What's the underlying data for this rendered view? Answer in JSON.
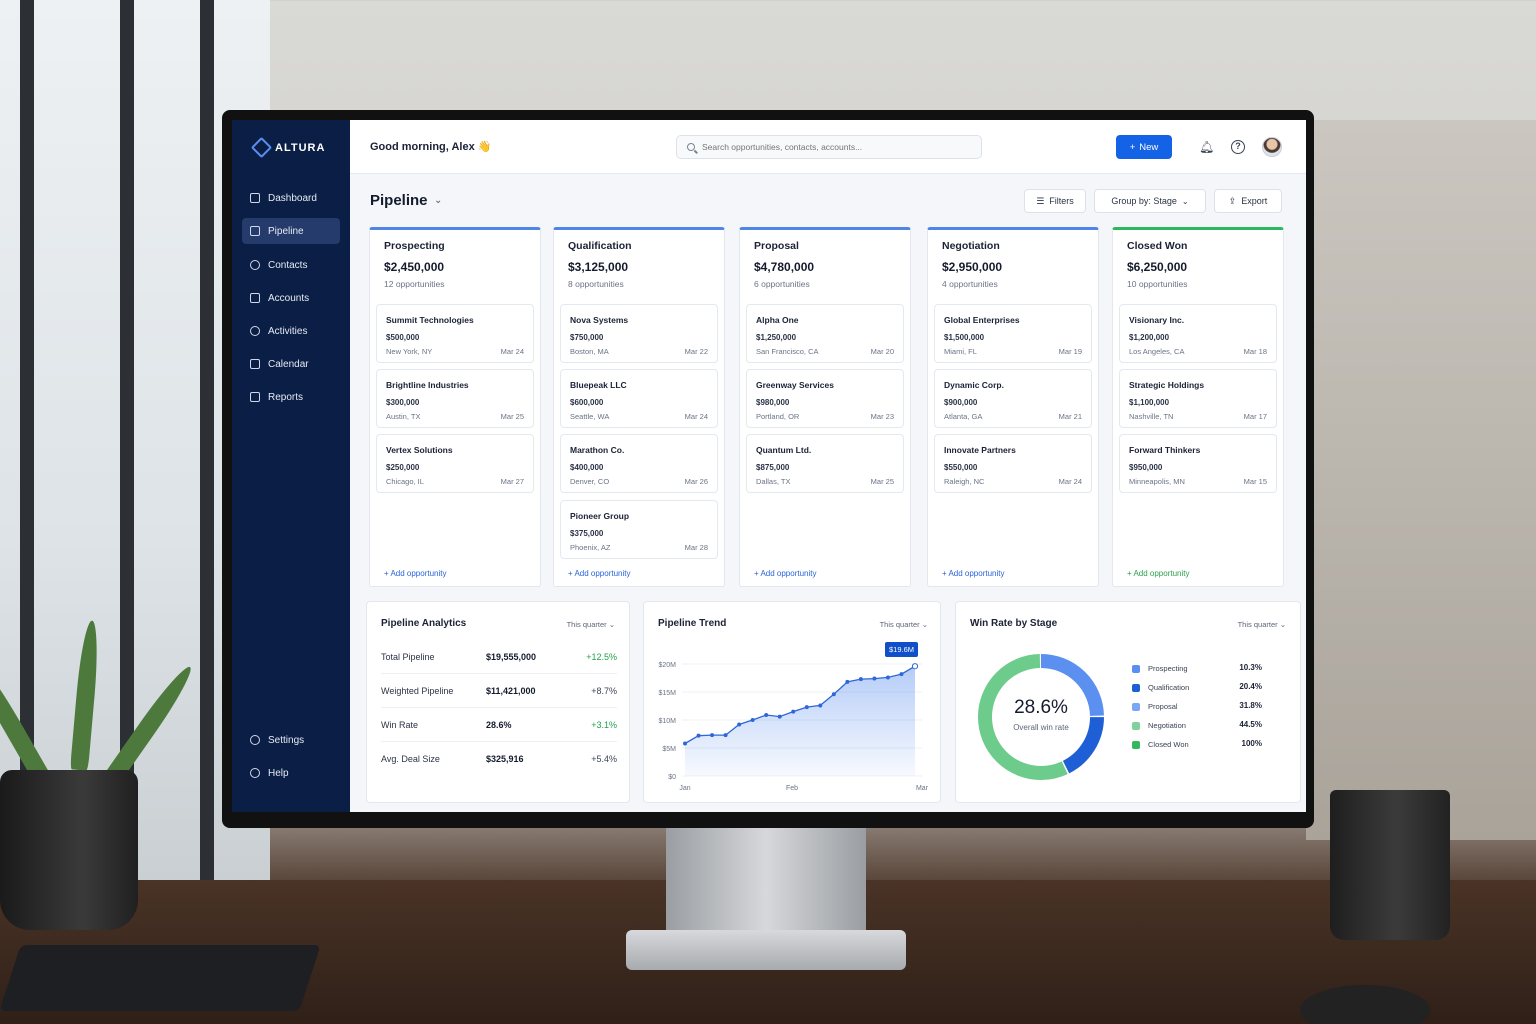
{
  "app": {
    "brand": "ALTURA",
    "greeting": "Good morning, Alex 👋"
  },
  "search": {
    "placeholder": "Search opportunities, contacts, accounts..."
  },
  "header": {
    "new_label": "New"
  },
  "sidebar": {
    "items": [
      {
        "label": "Dashboard",
        "icon": "dashboard-icon"
      },
      {
        "label": "Pipeline",
        "icon": "pipeline-icon",
        "active": true
      },
      {
        "label": "Contacts",
        "icon": "contacts-icon"
      },
      {
        "label": "Accounts",
        "icon": "accounts-icon"
      },
      {
        "label": "Activities",
        "icon": "activities-icon"
      },
      {
        "label": "Calendar",
        "icon": "calendar-icon"
      },
      {
        "label": "Reports",
        "icon": "reports-icon"
      }
    ],
    "bottom": [
      {
        "label": "Settings",
        "icon": "gear-icon"
      },
      {
        "label": "Help",
        "icon": "help-icon"
      }
    ]
  },
  "page": {
    "title": "Pipeline",
    "filters_label": "Filters",
    "group_label": "Group by: Stage",
    "export_label": "Export"
  },
  "stages": [
    {
      "name": "Prospecting",
      "total": "$2,450,000",
      "count": "12 opportunities",
      "deals": [
        {
          "name": "Summit Technologies",
          "amount": "$500,000",
          "location": "New York, NY",
          "date": "Mar 24"
        },
        {
          "name": "Brightline Industries",
          "amount": "$300,000",
          "location": "Austin, TX",
          "date": "Mar 25"
        },
        {
          "name": "Vertex Solutions",
          "amount": "$250,000",
          "location": "Chicago, IL",
          "date": "Mar 27"
        }
      ],
      "add": "+ Add opportunity"
    },
    {
      "name": "Qualification",
      "total": "$3,125,000",
      "count": "8 opportunities",
      "deals": [
        {
          "name": "Nova Systems",
          "amount": "$750,000",
          "location": "Boston, MA",
          "date": "Mar 22"
        },
        {
          "name": "Bluepeak LLC",
          "amount": "$600,000",
          "location": "Seattle, WA",
          "date": "Mar 24"
        },
        {
          "name": "Marathon Co.",
          "amount": "$400,000",
          "location": "Denver, CO",
          "date": "Mar 26"
        },
        {
          "name": "Pioneer Group",
          "amount": "$375,000",
          "location": "Phoenix, AZ",
          "date": "Mar 28"
        }
      ],
      "add": "+ Add opportunity"
    },
    {
      "name": "Proposal",
      "total": "$4,780,000",
      "count": "6 opportunities",
      "deals": [
        {
          "name": "Alpha One",
          "amount": "$1,250,000",
          "location": "San Francisco, CA",
          "date": "Mar 20"
        },
        {
          "name": "Greenway Services",
          "amount": "$980,000",
          "location": "Portland, OR",
          "date": "Mar 23"
        },
        {
          "name": "Quantum Ltd.",
          "amount": "$875,000",
          "location": "Dallas, TX",
          "date": "Mar 25"
        }
      ],
      "add": "+ Add opportunity"
    },
    {
      "name": "Negotiation",
      "total": "$2,950,000",
      "count": "4 opportunities",
      "deals": [
        {
          "name": "Global Enterprises",
          "amount": "$1,500,000",
          "location": "Miami, FL",
          "date": "Mar 19"
        },
        {
          "name": "Dynamic Corp.",
          "amount": "$900,000",
          "location": "Atlanta, GA",
          "date": "Mar 21"
        },
        {
          "name": "Innovate Partners",
          "amount": "$550,000",
          "location": "Raleigh, NC",
          "date": "Mar 24"
        }
      ],
      "add": "+ Add opportunity"
    },
    {
      "name": "Closed Won",
      "total": "$6,250,000",
      "count": "10 opportunities",
      "deals": [
        {
          "name": "Visionary Inc.",
          "amount": "$1,200,000",
          "location": "Los Angeles, CA",
          "date": "Mar 18"
        },
        {
          "name": "Strategic Holdings",
          "amount": "$1,100,000",
          "location": "Nashville, TN",
          "date": "Mar 17"
        },
        {
          "name": "Forward Thinkers",
          "amount": "$950,000",
          "location": "Minneapolis, MN",
          "date": "Mar 15"
        }
      ],
      "add": "+ Add opportunity"
    }
  ],
  "analytics": {
    "title": "Pipeline Analytics",
    "range": "This quarter",
    "metrics": [
      {
        "label": "Total Pipeline",
        "value": "$19,555,000",
        "change": "+12.5%",
        "positive": true
      },
      {
        "label": "Weighted Pipeline",
        "value": "$11,421,000",
        "change": "+8.7%",
        "positive": false
      },
      {
        "label": "Win Rate",
        "value": "28.6%",
        "change": "+3.1%",
        "positive": true
      },
      {
        "label": "Avg. Deal Size",
        "value": "$325,916",
        "change": "+5.4%",
        "positive": false
      }
    ]
  },
  "trend": {
    "title": "Pipeline Trend",
    "range": "This quarter",
    "badge": "$19.6M"
  },
  "winrate": {
    "title": "Win Rate by Stage",
    "range": "This quarter",
    "center_value": "28.6%",
    "center_label": "Overall win rate",
    "legend": [
      {
        "name": "Prospecting",
        "value": "10.3%",
        "color": "#5b8ff0"
      },
      {
        "name": "Qualification",
        "value": "20.4%",
        "color": "#1f5fd6"
      },
      {
        "name": "Proposal",
        "value": "31.8%",
        "color": "#7aa7f5"
      },
      {
        "name": "Negotiation",
        "value": "44.5%",
        "color": "#7fd39a"
      },
      {
        "name": "Closed Won",
        "value": "100%",
        "color": "#34b85d"
      }
    ]
  },
  "chart_data": [
    {
      "type": "area",
      "title": "Pipeline Trend",
      "x_ticks": [
        "Jan",
        "Feb",
        "Mar"
      ],
      "y_ticks": [
        "$0",
        "$5M",
        "$10M",
        "$15M",
        "$20M"
      ],
      "ylim": [
        0,
        20
      ],
      "series": [
        {
          "values": [
            5.8,
            7.2,
            7.3,
            7.3,
            9.2,
            10.0,
            10.9,
            10.6,
            11.5,
            12.3,
            12.6,
            14.6,
            16.8,
            17.3,
            17.4,
            17.6,
            18.2,
            19.6
          ]
        }
      ],
      "grid": true
    },
    {
      "type": "pie",
      "title": "Win Rate by Stage",
      "categories": [
        "Prospecting",
        "Qualification",
        "Proposal",
        "Negotiation",
        "Closed Won"
      ],
      "values": [
        10.3,
        20.4,
        31.8,
        44.5,
        100
      ]
    }
  ]
}
